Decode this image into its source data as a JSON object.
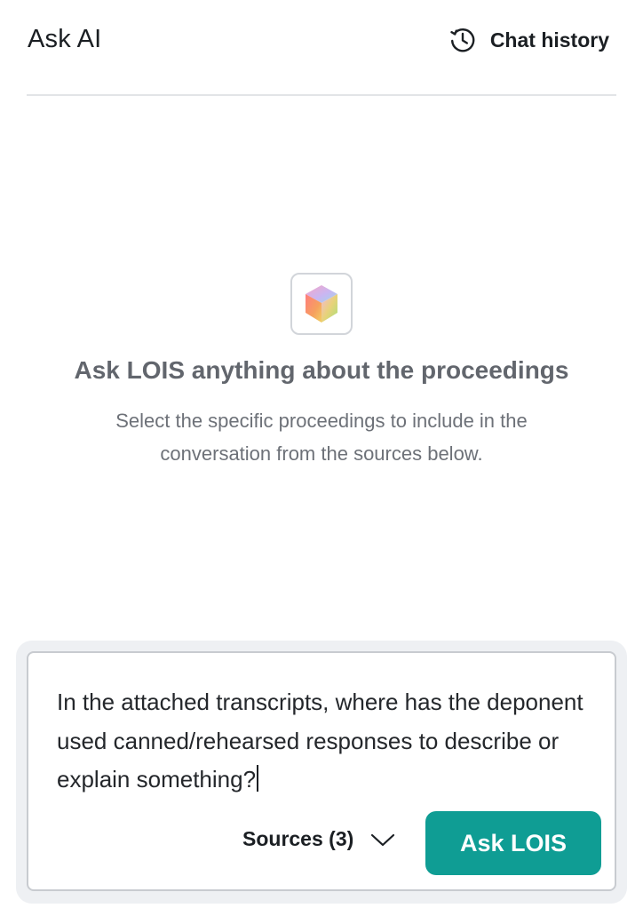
{
  "header": {
    "title": "Ask AI",
    "history_label": "Chat history",
    "history_icon": "clock-history-icon"
  },
  "empty_state": {
    "icon": "gradient-cube-icon",
    "heading": "Ask LOIS anything about the proceedings",
    "subtitle": "Select the specific proceedings to include in the conversation from the sources below."
  },
  "composer": {
    "input_value": "In the attached transcripts, where has the deponent used canned/rehearsed responses to describe or explain something?",
    "sources_label": "Sources (3)",
    "sources_icon": "chevron-down-icon",
    "submit_label": "Ask LOIS"
  },
  "colors": {
    "accent": "#0f9d94",
    "composer_background": "#eef0f3",
    "border": "#c8cbd0"
  }
}
